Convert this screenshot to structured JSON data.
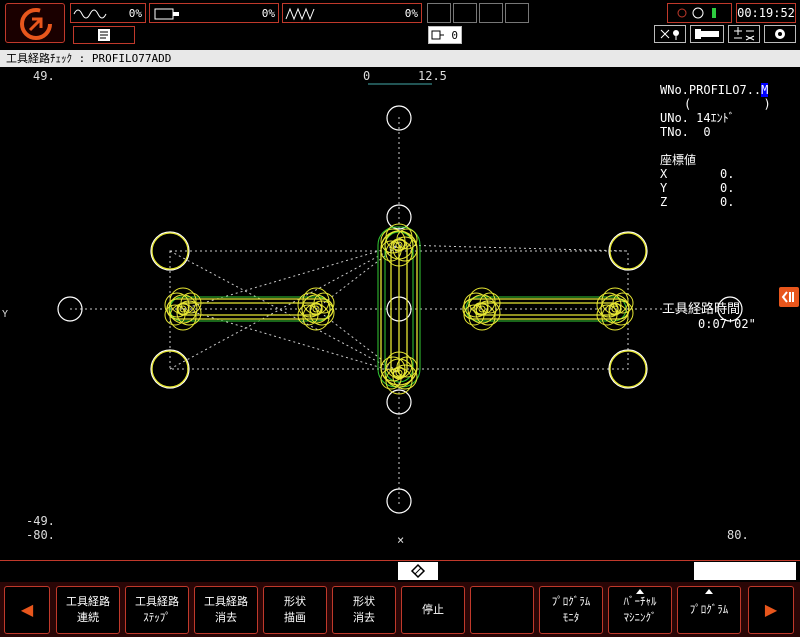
{
  "topbar": {
    "meters": [
      {
        "name": "spindle-load",
        "value": "0%"
      },
      {
        "name": "feed-load",
        "value": "0%"
      },
      {
        "name": "axis-load",
        "value": "0%"
      }
    ],
    "counter_value": "0",
    "clock": "00:19:52"
  },
  "title": "工具経路ﾁｪｯｸ : PROFILO77ADD",
  "plot": {
    "y_max_label": "49.",
    "y_min_label": "-49.",
    "x_min_label": "-80.",
    "x_max_label": "80.",
    "scale_start": "0",
    "scale_end": "12.5",
    "y_axis_label": "Y",
    "x_axis_label": "×"
  },
  "info": {
    "wno_prefix": "WNo.PROFILO7..",
    "wno_suffix": "M",
    "paren": "(          )",
    "uno": "UNo. 14ｴﾝﾄﾞ",
    "tno": "TNo.  0",
    "coord_title": "座標値",
    "coords": [
      {
        "axis": "X",
        "value": "0."
      },
      {
        "axis": "Y",
        "value": "0."
      },
      {
        "axis": "Z",
        "value": "0."
      }
    ],
    "time_label": "工具経路時間",
    "time_value": "0:07'02\""
  },
  "softkeys": {
    "k1": [
      "工具経路",
      "連続"
    ],
    "k2": [
      "工具経路",
      "ｽﾃｯﾌﾟ"
    ],
    "k3": [
      "工具経路",
      "消去"
    ],
    "k4": [
      "形状",
      "描画"
    ],
    "k5": [
      "形状",
      "消去"
    ],
    "k6": [
      "停止"
    ],
    "k7": [],
    "k8": [
      "ﾌﾟﾛｸﾞﾗﾑ",
      "ﾓﾆﾀ"
    ],
    "k9": [
      "ﾊﾞｰﾁｬﾙ",
      "ﾏｼﾆﾝｸﾞ"
    ],
    "k10": [
      "ﾌﾟﾛｸﾞﾗﾑ"
    ]
  },
  "colors": {
    "accent": "#c0392b",
    "orange": "#e8561c",
    "path_yellow": "#e6e633",
    "path_green": "#33cc33",
    "dotted": "#cccccc"
  }
}
